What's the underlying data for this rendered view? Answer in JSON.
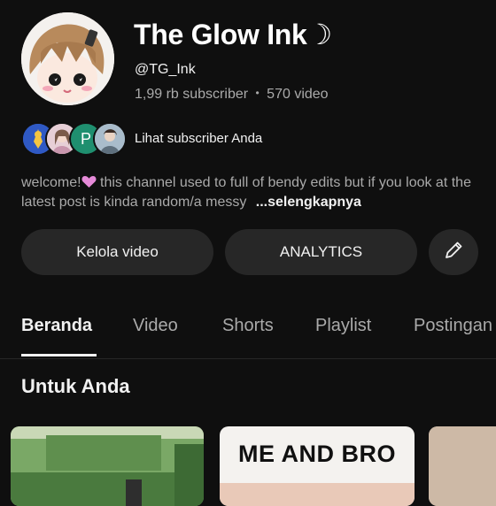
{
  "channel": {
    "name": "The Glow Ink☽",
    "handle": "@TG_Ink",
    "subscribers": "1,99 rb subscriber",
    "separator": "•",
    "videos": "570 video"
  },
  "subscribers_link": "Lihat subscriber Anda",
  "description": {
    "text_before_icon": "welcome!",
    "text_after_icon": " this channel used to full of bendy edits but if you look at the latest post is kinda random/a messy ",
    "more": "...selengkapnya"
  },
  "buttons": {
    "manage": "Kelola video",
    "analytics": "ANALYTICS"
  },
  "tabs": [
    "Beranda",
    "Video",
    "Shorts",
    "Playlist",
    "Postingan"
  ],
  "active_tab": "Beranda",
  "section_title": "Untuk Anda",
  "thumbnails": [
    {
      "text": ""
    },
    {
      "text": "ME AND BRO"
    },
    {
      "text": ""
    }
  ],
  "sub_avatar_letter": "P",
  "colors": {
    "background": "#0f0f0f",
    "button": "#272727",
    "muted_text": "#aaaaaa",
    "heart": "#e58ad8"
  },
  "icons": [
    "heart-icon",
    "pencil-icon"
  ]
}
